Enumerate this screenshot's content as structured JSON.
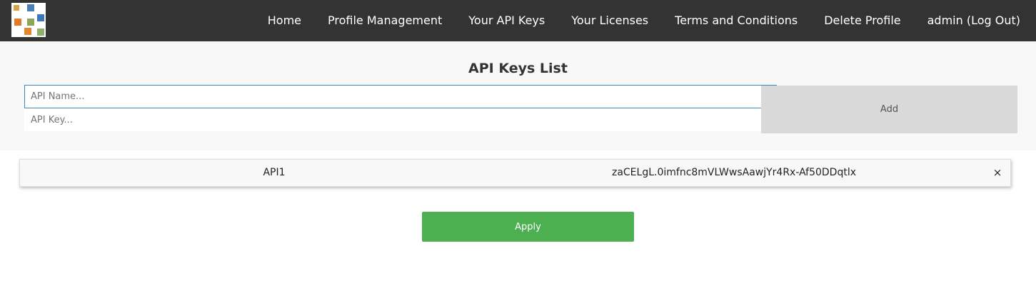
{
  "navbar": {
    "logo_icon": "app-logo-icon",
    "links": [
      {
        "label": "Home"
      },
      {
        "label": "Profile Management"
      },
      {
        "label": "Your API Keys"
      },
      {
        "label": "Your Licenses"
      },
      {
        "label": "Terms and Conditions"
      },
      {
        "label": "Delete Profile"
      },
      {
        "label": "admin (Log Out)"
      }
    ]
  },
  "main": {
    "title": "API Keys List",
    "name_input": {
      "value": "",
      "placeholder": "API Name..."
    },
    "key_input": {
      "value": "",
      "placeholder": "API Key..."
    },
    "add_label": "Add",
    "keys": [
      {
        "name": "API1",
        "key": "zaCELgL.0imfnc8mVLWwsAawjYr4Rx-Af50DDqtlx",
        "delete_icon": "×"
      }
    ],
    "apply_label": "Apply"
  },
  "colors": {
    "navbar_bg": "#333333",
    "panel_bg": "#f8f8f8",
    "add_button_bg": "#d9d9d9",
    "apply_button_bg": "#4caf50",
    "input_focus_border": "#3a87c7"
  }
}
